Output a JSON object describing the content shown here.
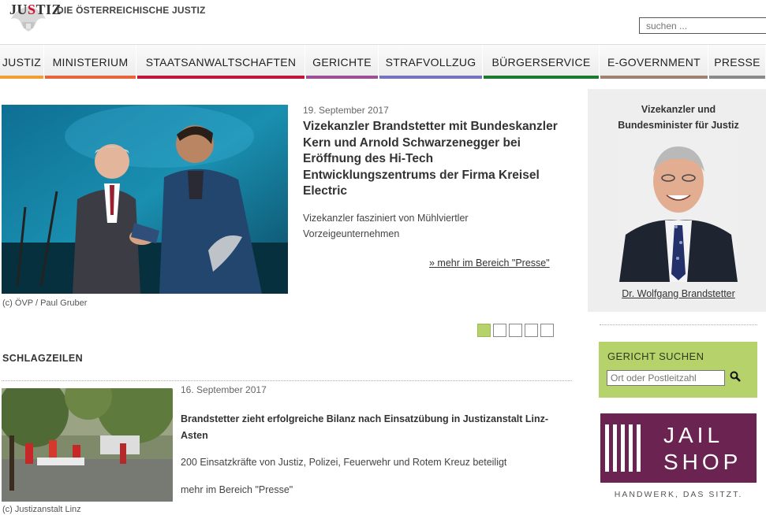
{
  "header": {
    "logo_prefix": "JU",
    "logo_accent": "S",
    "logo_suffix": "TIZ",
    "site_title": "DIE ÖSTERREICHISCHE JUSTIZ",
    "search_placeholder": "suchen ..."
  },
  "nav": {
    "items": [
      {
        "label": "JUSTIZ",
        "color": "#f0a030"
      },
      {
        "label": "MINISTERIUM",
        "color": "#e8643c"
      },
      {
        "label": "STAATSANWALTSCHAFTEN",
        "color": "#c0163c"
      },
      {
        "label": "GERICHTE",
        "color": "#9b4f96"
      },
      {
        "label": "STRAFVOLLZUG",
        "color": "#7473bd"
      },
      {
        "label": "BÜRGERSERVICE",
        "color": "#1b7a2e"
      },
      {
        "label": "E-GOVERNMENT",
        "color": "#a08070"
      },
      {
        "label": "PRESSE",
        "color": "#8a8a8a"
      }
    ]
  },
  "feature": {
    "date": "19. September 2017",
    "title": "Vizekanzler Brandstetter mit Bundeskanzler Kern und Arnold Schwarzenegger bei Eröffnung des Hi-Tech Entwicklungszentrums der Firma Kreisel Electric",
    "subtitle": "Vizekanzler fasziniert von Mühlviertler Vorzeigeunternehmen",
    "more_link": "» mehr im Bereich \"Presse\"",
    "caption": "(c) ÖVP / Paul Gruber",
    "slides_total": 5,
    "slide_active": 1
  },
  "headlines": {
    "section_title": "SCHLAGZEILEN",
    "items": [
      {
        "date": "16. September 2017",
        "title": "Brandstetter zieht erfolgreiche Bilanz nach Einsatzübung in Justizanstalt Linz-Asten",
        "subtitle": "200 Einsatzkräfte von Justiz, Polizei, Feuerwehr und Rotem Kreuz beteiligt",
        "more_link": "mehr im Bereich \"Presse\"",
        "caption": "(c) Justizanstalt Linz"
      }
    ]
  },
  "sidebar": {
    "minister": {
      "title_line1": "Vizekanzler und",
      "title_line2": "Bundesminister für Justiz",
      "name": "Dr. Wolfgang Brandstetter"
    },
    "court_search": {
      "title": "GERICHT SUCHEN",
      "placeholder": "Ort oder Postleitzahl",
      "search_icon": "magnifier-icon"
    },
    "jail_shop": {
      "line1": "JAIL",
      "line2": "SHOP",
      "tagline": "HANDWERK, DAS SITZT.",
      "color": "#6b2452"
    }
  }
}
